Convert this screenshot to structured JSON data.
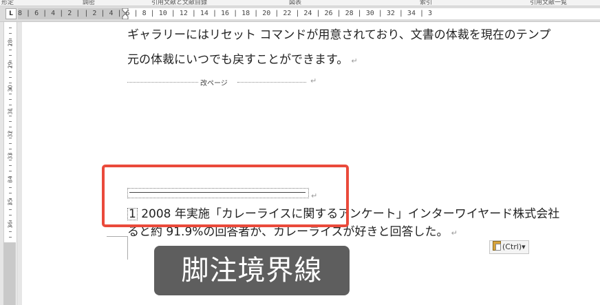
{
  "ribbon": {
    "group_labels": [
      "形定",
      "調密",
      "引用文献と文献目録",
      "図表",
      "索引",
      "引用文献一覧"
    ]
  },
  "rulers": {
    "tab_selector": "L",
    "horizontal_ticks": "8 | 6 | 4 | 2 |   | 2 | 4 | 6 | 8 | 10 | 12 | 14 | 16 | 18 | 20 | 22 | 24 | 26 | 28 | 30 | 32 | 34 | 3",
    "vertical_numbers": [
      "28",
      "29",
      "30",
      "31",
      "32",
      "33",
      "34",
      "35",
      "36",
      "37",
      "38",
      "39"
    ]
  },
  "document": {
    "body_line_1": "ギャラリーにはリセット コマンドが用意されており、文書の体裁を現在のテンプ",
    "body_line_2": "元の体裁にいつでも戻すことができます。",
    "page_break_label": "改ページ",
    "footnote_ref": "1",
    "footnote_line_1": " 2008 年実施「カレーライスに関するアンケート」インターワイヤード株式会社",
    "footnote_line_2": "ると約 91.9%の回答者が、カレーライスが好きと回答した。",
    "pilcrow": "↵"
  },
  "paste_options": {
    "label": "(Ctrl)▾"
  },
  "caption": {
    "text": "脚注境界線"
  },
  "colors": {
    "highlight": "#ea4a3b",
    "caption_bg": "#505050"
  }
}
